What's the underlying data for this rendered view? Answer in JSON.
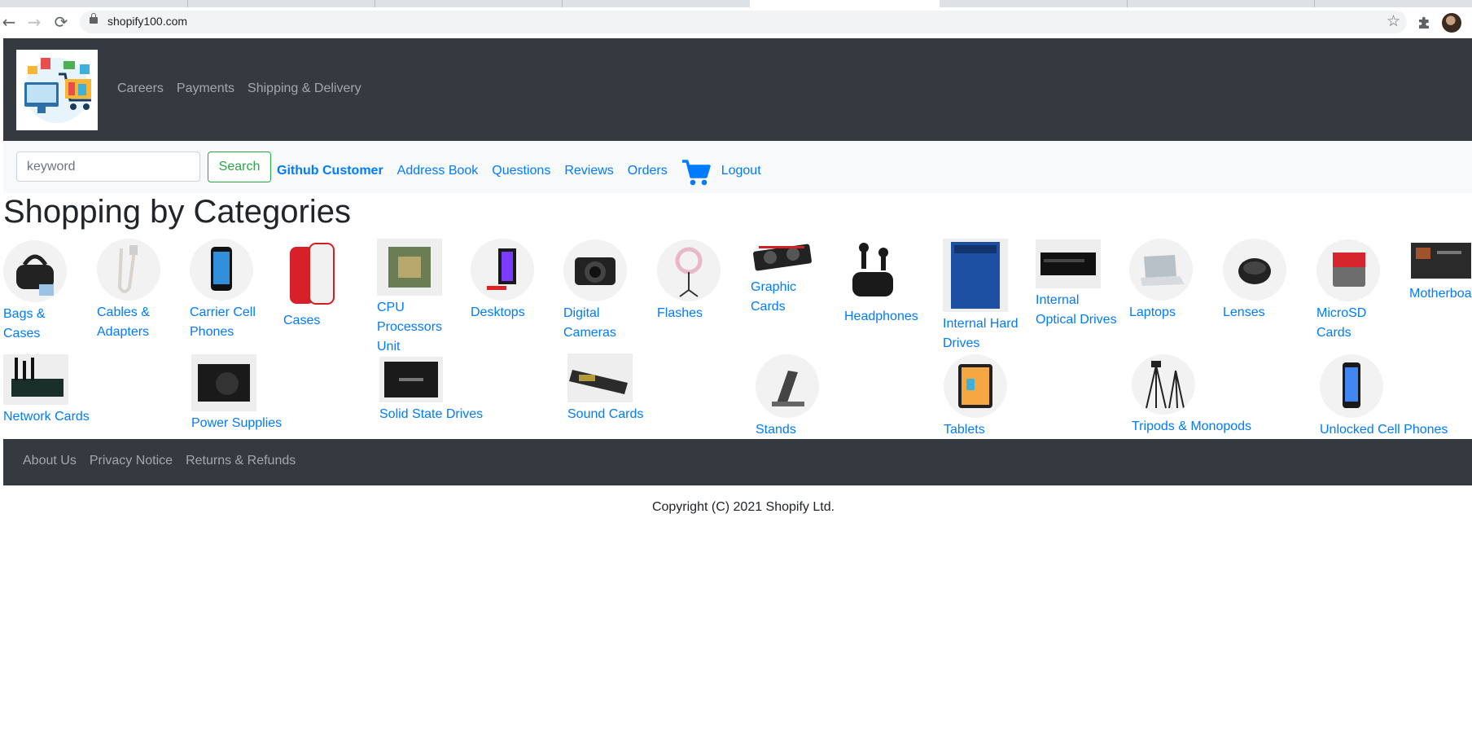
{
  "browser": {
    "url": "shopify100.com",
    "nav_back": "←",
    "nav_forward": "→",
    "nav_reload": "⟳",
    "bookmark_star": "☆"
  },
  "header": {
    "logo_icon": "shopping-cart-illustration",
    "links": [
      "Careers",
      "Payments",
      "Shipping & Delivery"
    ]
  },
  "subnav": {
    "search_placeholder": "keyword",
    "search_button": "Search",
    "customer_name": "Github Customer",
    "links": [
      "Address Book",
      "Questions",
      "Reviews",
      "Orders"
    ],
    "cart_icon": "shopping-cart-icon",
    "logout": "Logout"
  },
  "page_title": "Shopping by Categories",
  "categories": [
    {
      "label": "Bags & Cases",
      "icon": "bag-icon"
    },
    {
      "label": "Cables & Adapters",
      "icon": "cable-icon"
    },
    {
      "label": "Carrier Cell Phones",
      "icon": "phone-icon"
    },
    {
      "label": "Cases",
      "icon": "phone-case-icon"
    },
    {
      "label": "CPU Processors Unit",
      "icon": "cpu-icon"
    },
    {
      "label": "Desktops",
      "icon": "desktop-icon"
    },
    {
      "label": "Digital Cameras",
      "icon": "camera-icon"
    },
    {
      "label": "Flashes",
      "icon": "ring-light-icon"
    },
    {
      "label": "Graphic Cards",
      "icon": "gpu-icon"
    },
    {
      "label": "Headphones",
      "icon": "earbuds-icon"
    },
    {
      "label": "Internal Hard Drives",
      "icon": "hdd-icon"
    },
    {
      "label": "Internal Optical Drives",
      "icon": "optical-drive-icon"
    },
    {
      "label": "Laptops",
      "icon": "laptop-icon"
    },
    {
      "label": "Lenses",
      "icon": "lens-icon"
    },
    {
      "label": "MicroSD Cards",
      "icon": "sd-card-icon"
    },
    {
      "label": "Motherboards",
      "icon": "motherboard-icon"
    },
    {
      "label": "Network Cards",
      "icon": "network-card-icon"
    },
    {
      "label": "Power Supplies",
      "icon": "psu-icon"
    },
    {
      "label": "Solid State Drives",
      "icon": "ssd-icon"
    },
    {
      "label": "Sound Cards",
      "icon": "sound-card-icon"
    },
    {
      "label": "Stands",
      "icon": "stand-icon"
    },
    {
      "label": "Tablets",
      "icon": "tablet-icon"
    },
    {
      "label": "Tripods & Monopods",
      "icon": "tripod-icon"
    },
    {
      "label": "Unlocked Cell Phones",
      "icon": "phone-icon"
    }
  ],
  "footer": {
    "links": [
      "About Us",
      "Privacy Notice",
      "Returns & Refunds"
    ],
    "copyright": "Copyright (C) 2021 Shopify Ltd."
  },
  "colors": {
    "navbar": "#343a40",
    "link": "#007bff",
    "success": "#28a745"
  }
}
